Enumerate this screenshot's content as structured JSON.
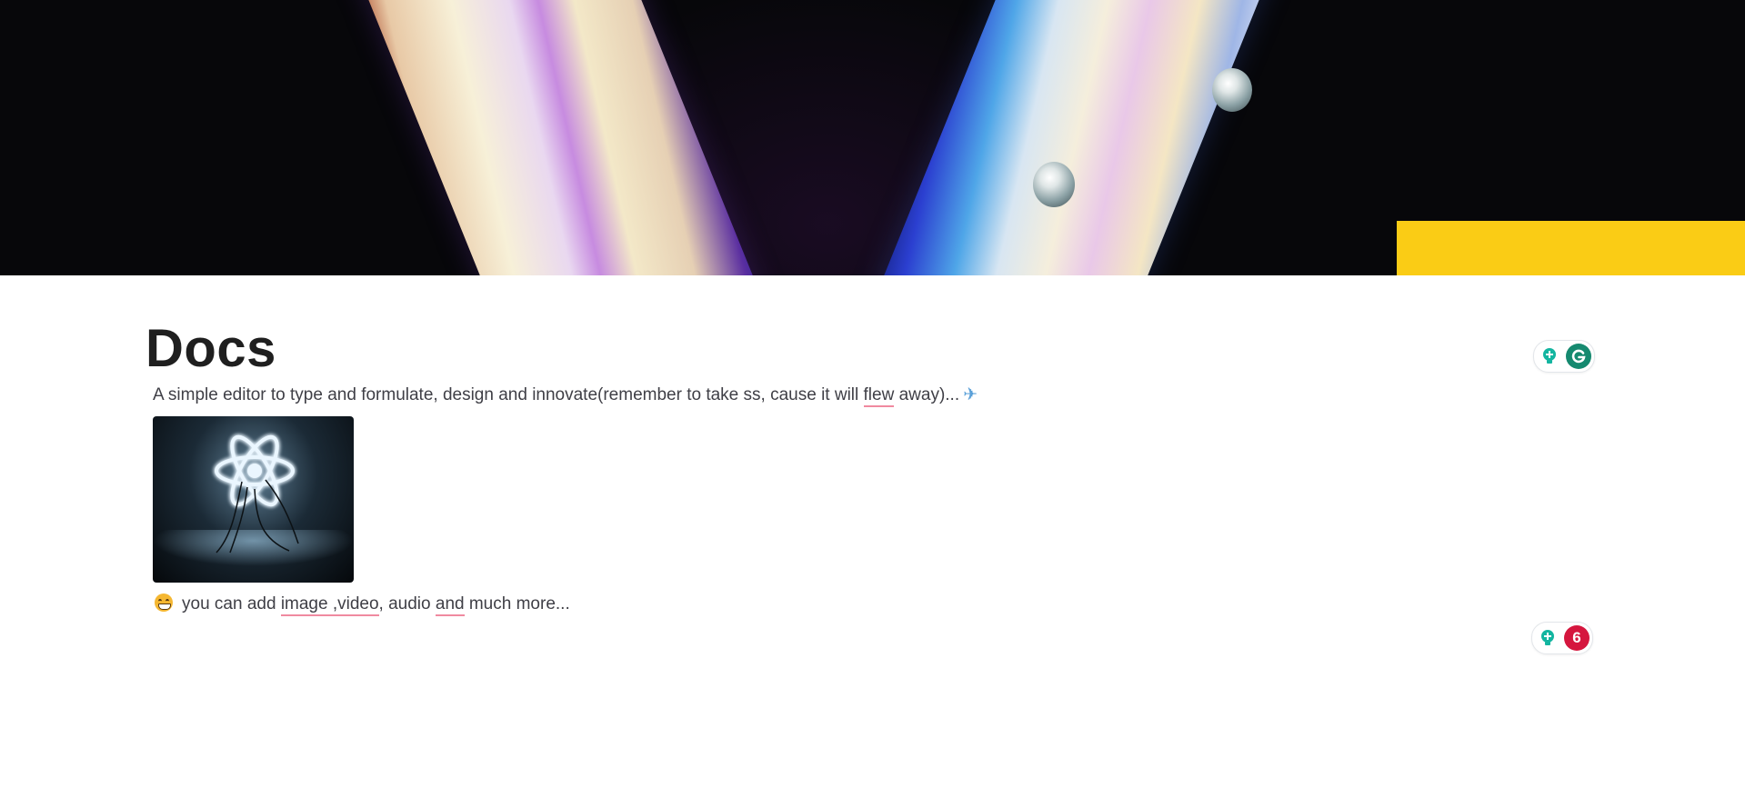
{
  "document": {
    "title": "Docs",
    "description": "A simple editor to type and formulate, design and innovate(remember to take ss, cause it will ",
    "description_misspelled": "flew",
    "description_end": " away)...",
    "description_emoji": "✈",
    "media_note": {
      "emoji": "grinning-face-icon",
      "text_prefix": "you can add ",
      "misspelled_1": "image ,video",
      "text_middle": ", audio ",
      "misspelled_2": "and",
      "text_suffix": " much more..."
    }
  },
  "cover": {
    "accent_color": "#facc15"
  },
  "grammar_widgets": [
    {
      "icon": "grammarly-g-icon",
      "badge_color": "#15896f",
      "label": ""
    },
    {
      "icon": "error-count-icon",
      "badge_color": "#d5163e",
      "label": "6"
    }
  ]
}
